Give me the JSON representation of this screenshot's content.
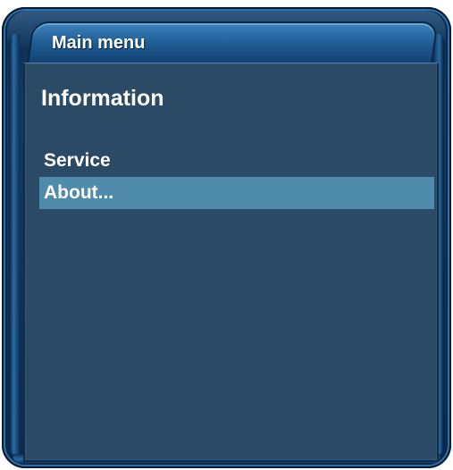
{
  "window": {
    "title": "Main menu"
  },
  "page": {
    "heading": "Information"
  },
  "menu": {
    "items": [
      {
        "label": "Service",
        "selected": false
      },
      {
        "label": "About...",
        "selected": true
      }
    ]
  },
  "colors": {
    "panel_background": "#2b4a66",
    "selection_highlight": "#4f8bab",
    "frame": "#103a66",
    "text": "#ffffff"
  }
}
